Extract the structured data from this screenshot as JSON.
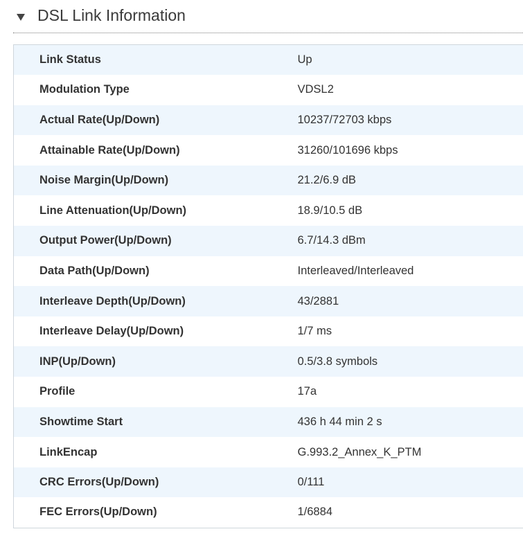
{
  "section": {
    "title": "DSL Link Information"
  },
  "rows": [
    {
      "label": "Link Status",
      "value": "Up"
    },
    {
      "label": "Modulation Type",
      "value": "VDSL2"
    },
    {
      "label": "Actual Rate(Up/Down)",
      "value": "10237/72703 kbps"
    },
    {
      "label": "Attainable Rate(Up/Down)",
      "value": "31260/101696 kbps"
    },
    {
      "label": "Noise Margin(Up/Down)",
      "value": "21.2/6.9 dB"
    },
    {
      "label": "Line Attenuation(Up/Down)",
      "value": "18.9/10.5 dB"
    },
    {
      "label": "Output Power(Up/Down)",
      "value": "6.7/14.3 dBm"
    },
    {
      "label": "Data Path(Up/Down)",
      "value": "Interleaved/Interleaved"
    },
    {
      "label": "Interleave Depth(Up/Down)",
      "value": "43/2881"
    },
    {
      "label": "Interleave Delay(Up/Down)",
      "value": "1/7 ms"
    },
    {
      "label": "INP(Up/Down)",
      "value": "0.5/3.8 symbols"
    },
    {
      "label": "Profile",
      "value": "17a"
    },
    {
      "label": "Showtime Start",
      "value": "436 h 44 min 2 s"
    },
    {
      "label": "LinkEncap",
      "value": "G.993.2_Annex_K_PTM"
    },
    {
      "label": "CRC Errors(Up/Down)",
      "value": "0/111"
    },
    {
      "label": "FEC Errors(Up/Down)",
      "value": "1/6884"
    }
  ],
  "icons": {
    "collapse": "triangle-down-icon"
  }
}
